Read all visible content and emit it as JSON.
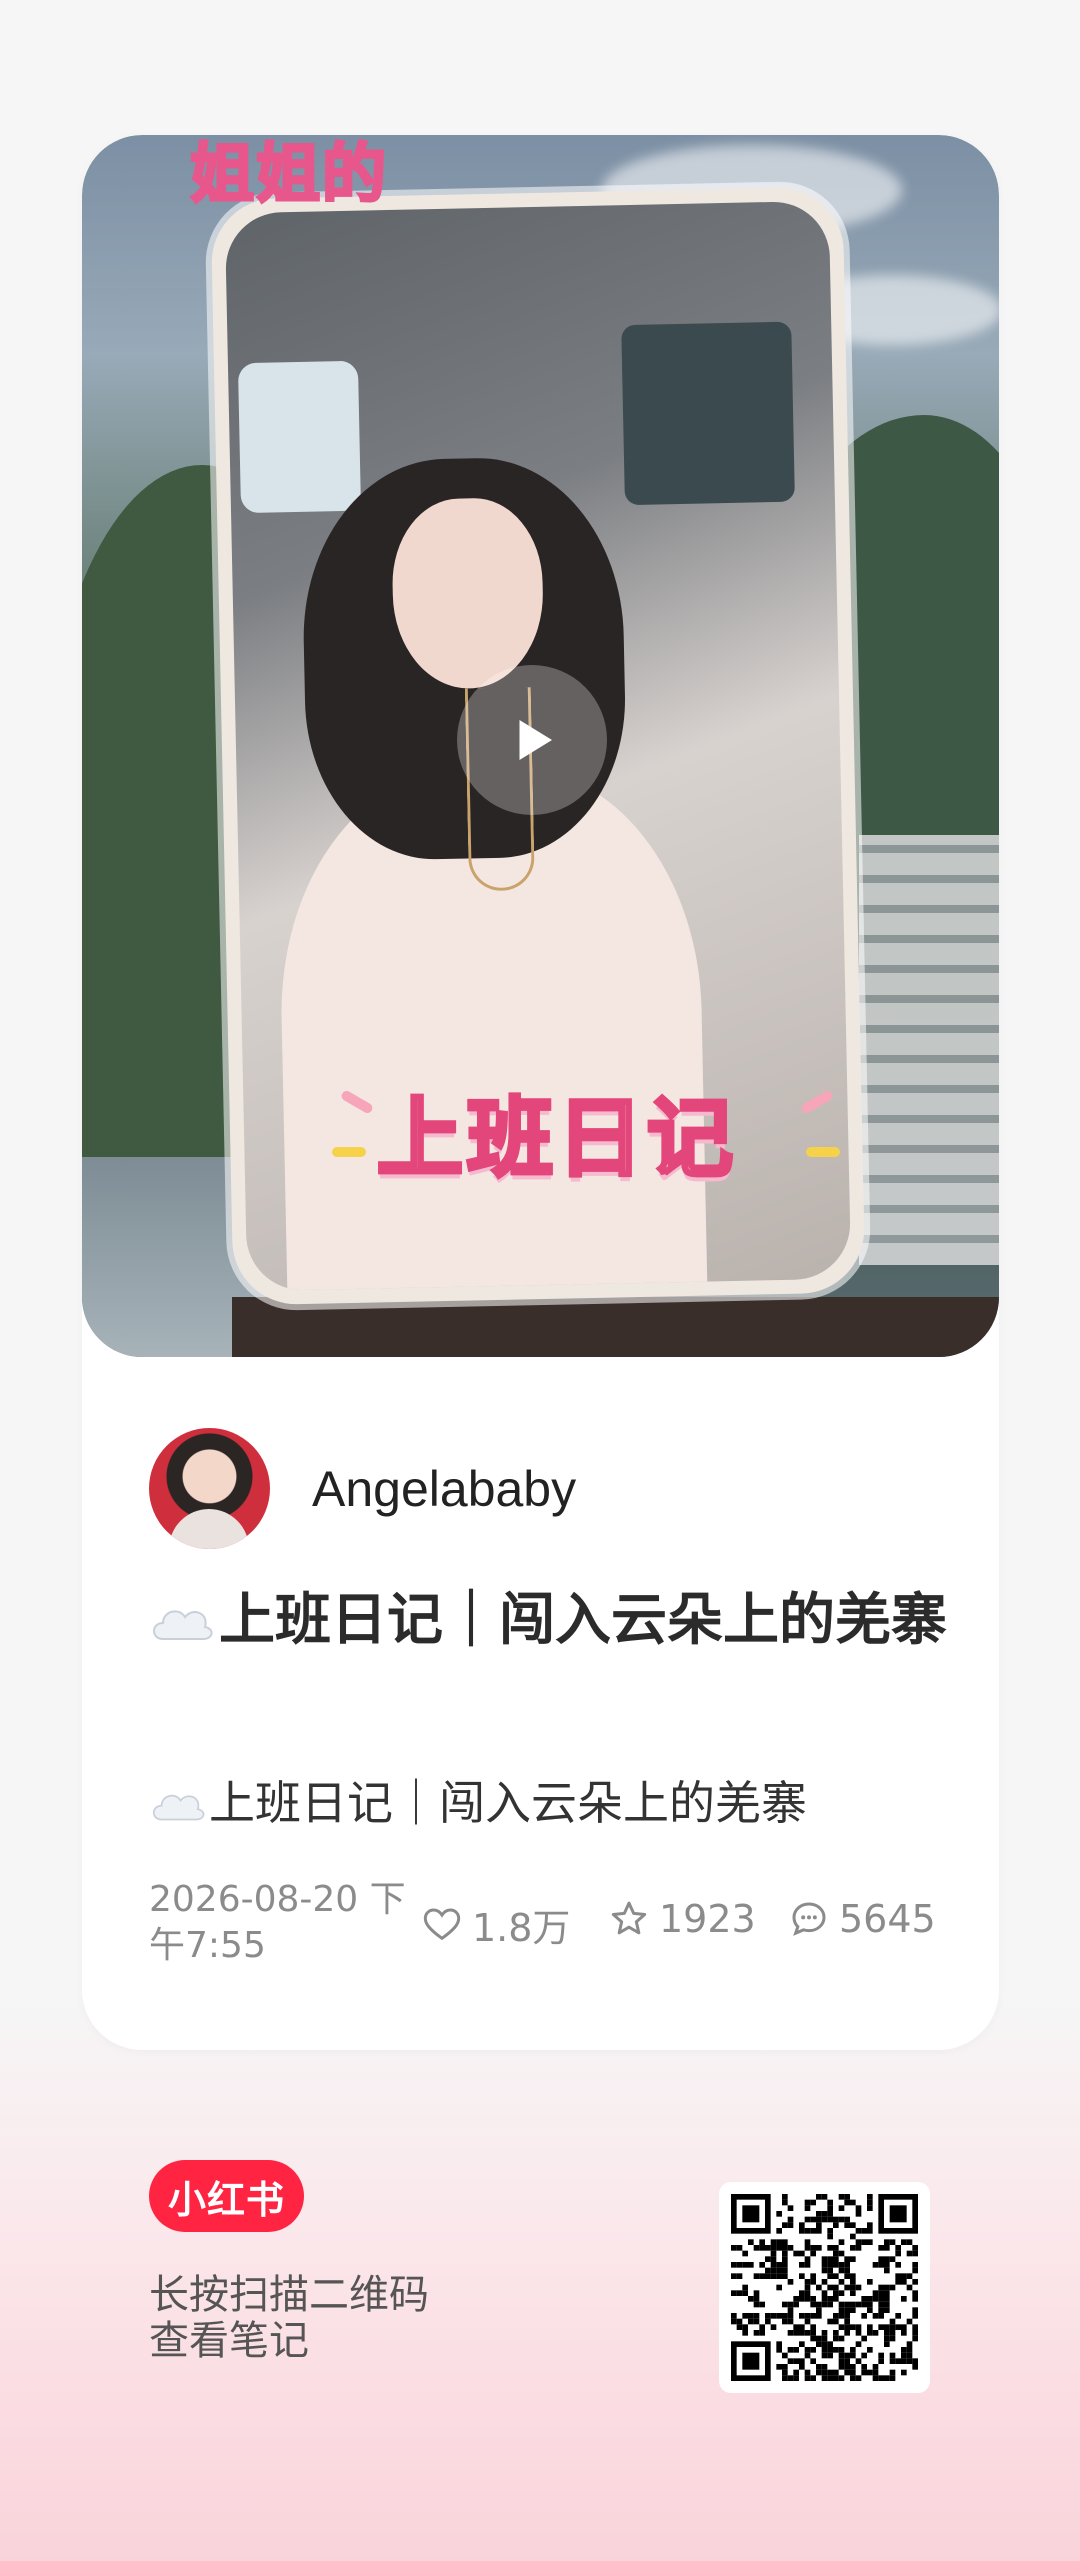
{
  "cover": {
    "top_sticker": "姐姐的",
    "main_sticker": "上班日记"
  },
  "author": {
    "name": "Angelababy"
  },
  "note": {
    "title": "上班日记｜闯入云朵上的羌寨",
    "description": "上班日记｜闯入云朵上的羌寨",
    "date": "2026-08-20 下午7:55"
  },
  "stats": {
    "likes": "1.8万",
    "collects": "1923",
    "comments": "5645"
  },
  "footer": {
    "logo_text": "小红书",
    "hint_line1": "长按扫描二维码",
    "hint_line2": "查看笔记"
  },
  "colors": {
    "brand": "#ff2442",
    "sticker_stroke": "#e2467a"
  },
  "icons": [
    "play-icon",
    "cloud-emoji-icon",
    "heart-icon",
    "star-icon",
    "comment-icon",
    "qr-code-icon"
  ]
}
